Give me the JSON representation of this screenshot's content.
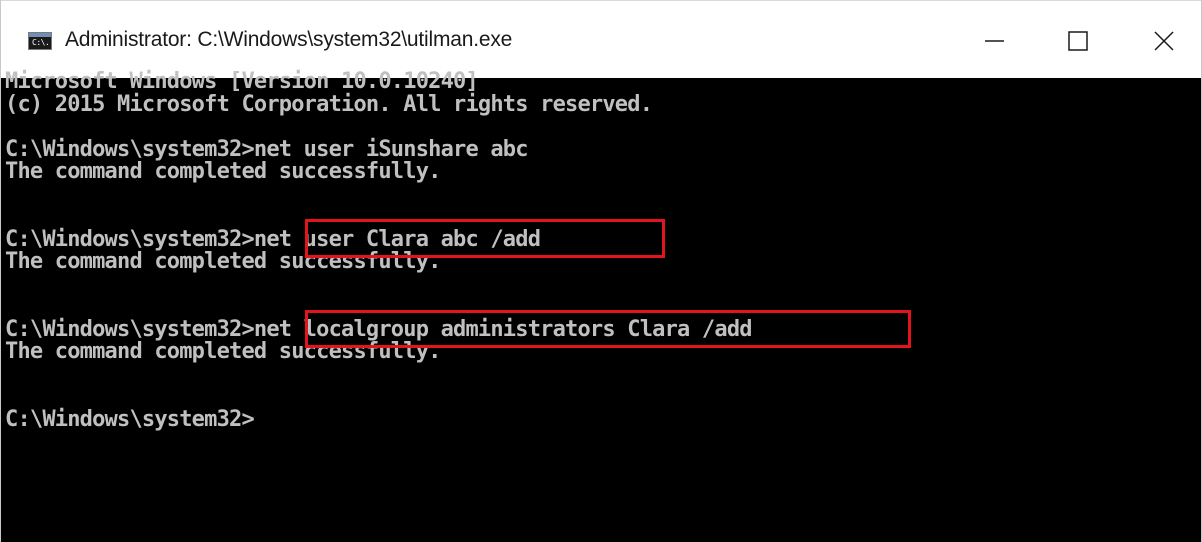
{
  "window": {
    "title": "Administrator: C:\\Windows\\system32\\utilman.exe",
    "icon_text": "C:\\."
  },
  "controls": {
    "minimize_icon": "minimize-icon",
    "maximize_icon": "maximize-icon",
    "close_icon": "close-icon"
  },
  "console": {
    "lines": [
      "Microsoft Windows [Version 10.0.10240]",
      "(c) 2015 Microsoft Corporation. All rights reserved.",
      "C:\\Windows\\system32>net user iSunshare abc",
      "The command completed successfully.",
      "C:\\Windows\\system32>net user Clara abc /add",
      "The command completed successfully.",
      "C:\\Windows\\system32>net localgroup administrators Clara /add",
      "The command completed successfully.",
      "C:\\Windows\\system32>"
    ]
  },
  "colors": {
    "console_bg": "#000000",
    "console_text": "#c0c0c0",
    "highlight": "#e3141b"
  }
}
